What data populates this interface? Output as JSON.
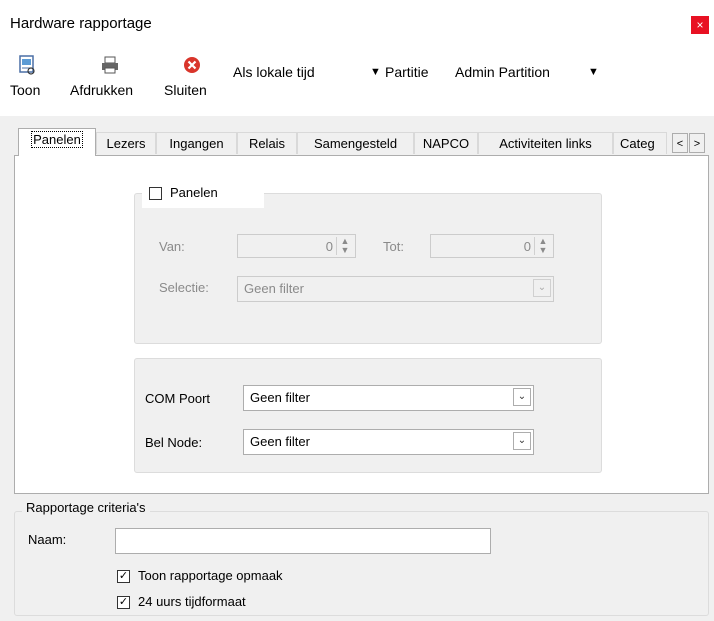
{
  "window": {
    "title": "Hardware rapportage",
    "close_glyph": "×"
  },
  "toolbar": {
    "show_label": "Toon",
    "print_label": "Afdrukken",
    "close_label": "Sluiten",
    "time_select": "Als lokale tijd",
    "partition_label": "Partitie",
    "partition_select": "Admin Partition",
    "dropdown_glyph": "▼"
  },
  "tabs": [
    {
      "label": "Panelen",
      "active": true
    },
    {
      "label": "Lezers"
    },
    {
      "label": "Ingangen"
    },
    {
      "label": "Relais"
    },
    {
      "label": "Samengesteld"
    },
    {
      "label": "NAPCO"
    },
    {
      "label": "Activiteiten links"
    },
    {
      "label": "Categ"
    }
  ],
  "tab_scroll": {
    "left": "<",
    "right": ">"
  },
  "panels_group": {
    "checkbox_label": "Panelen",
    "checked": false,
    "from_label": "Van:",
    "from_value": "0",
    "to_label": "Tot:",
    "to_value": "0",
    "selection_label": "Selectie:",
    "selection_value": "Geen filter"
  },
  "com_group": {
    "com_label": "COM Poort",
    "com_value": "Geen filter",
    "bell_label": "Bel Node:",
    "bell_value": "Geen filter"
  },
  "criteria": {
    "legend": "Rapportage criteria's",
    "name_label": "Naam:",
    "name_value": "",
    "show_layout_label": "Toon rapportage opmaak",
    "show_layout_checked": true,
    "time24_label": "24 uurs tijdformaat",
    "time24_checked": true
  },
  "glyphs": {
    "check": "✓",
    "combo_arrow": "⌄",
    "spin": "▲▼"
  },
  "colors": {
    "close_button": "#e81123",
    "window_bg": "#f0f0f0",
    "panel_bg": "#ffffff"
  }
}
